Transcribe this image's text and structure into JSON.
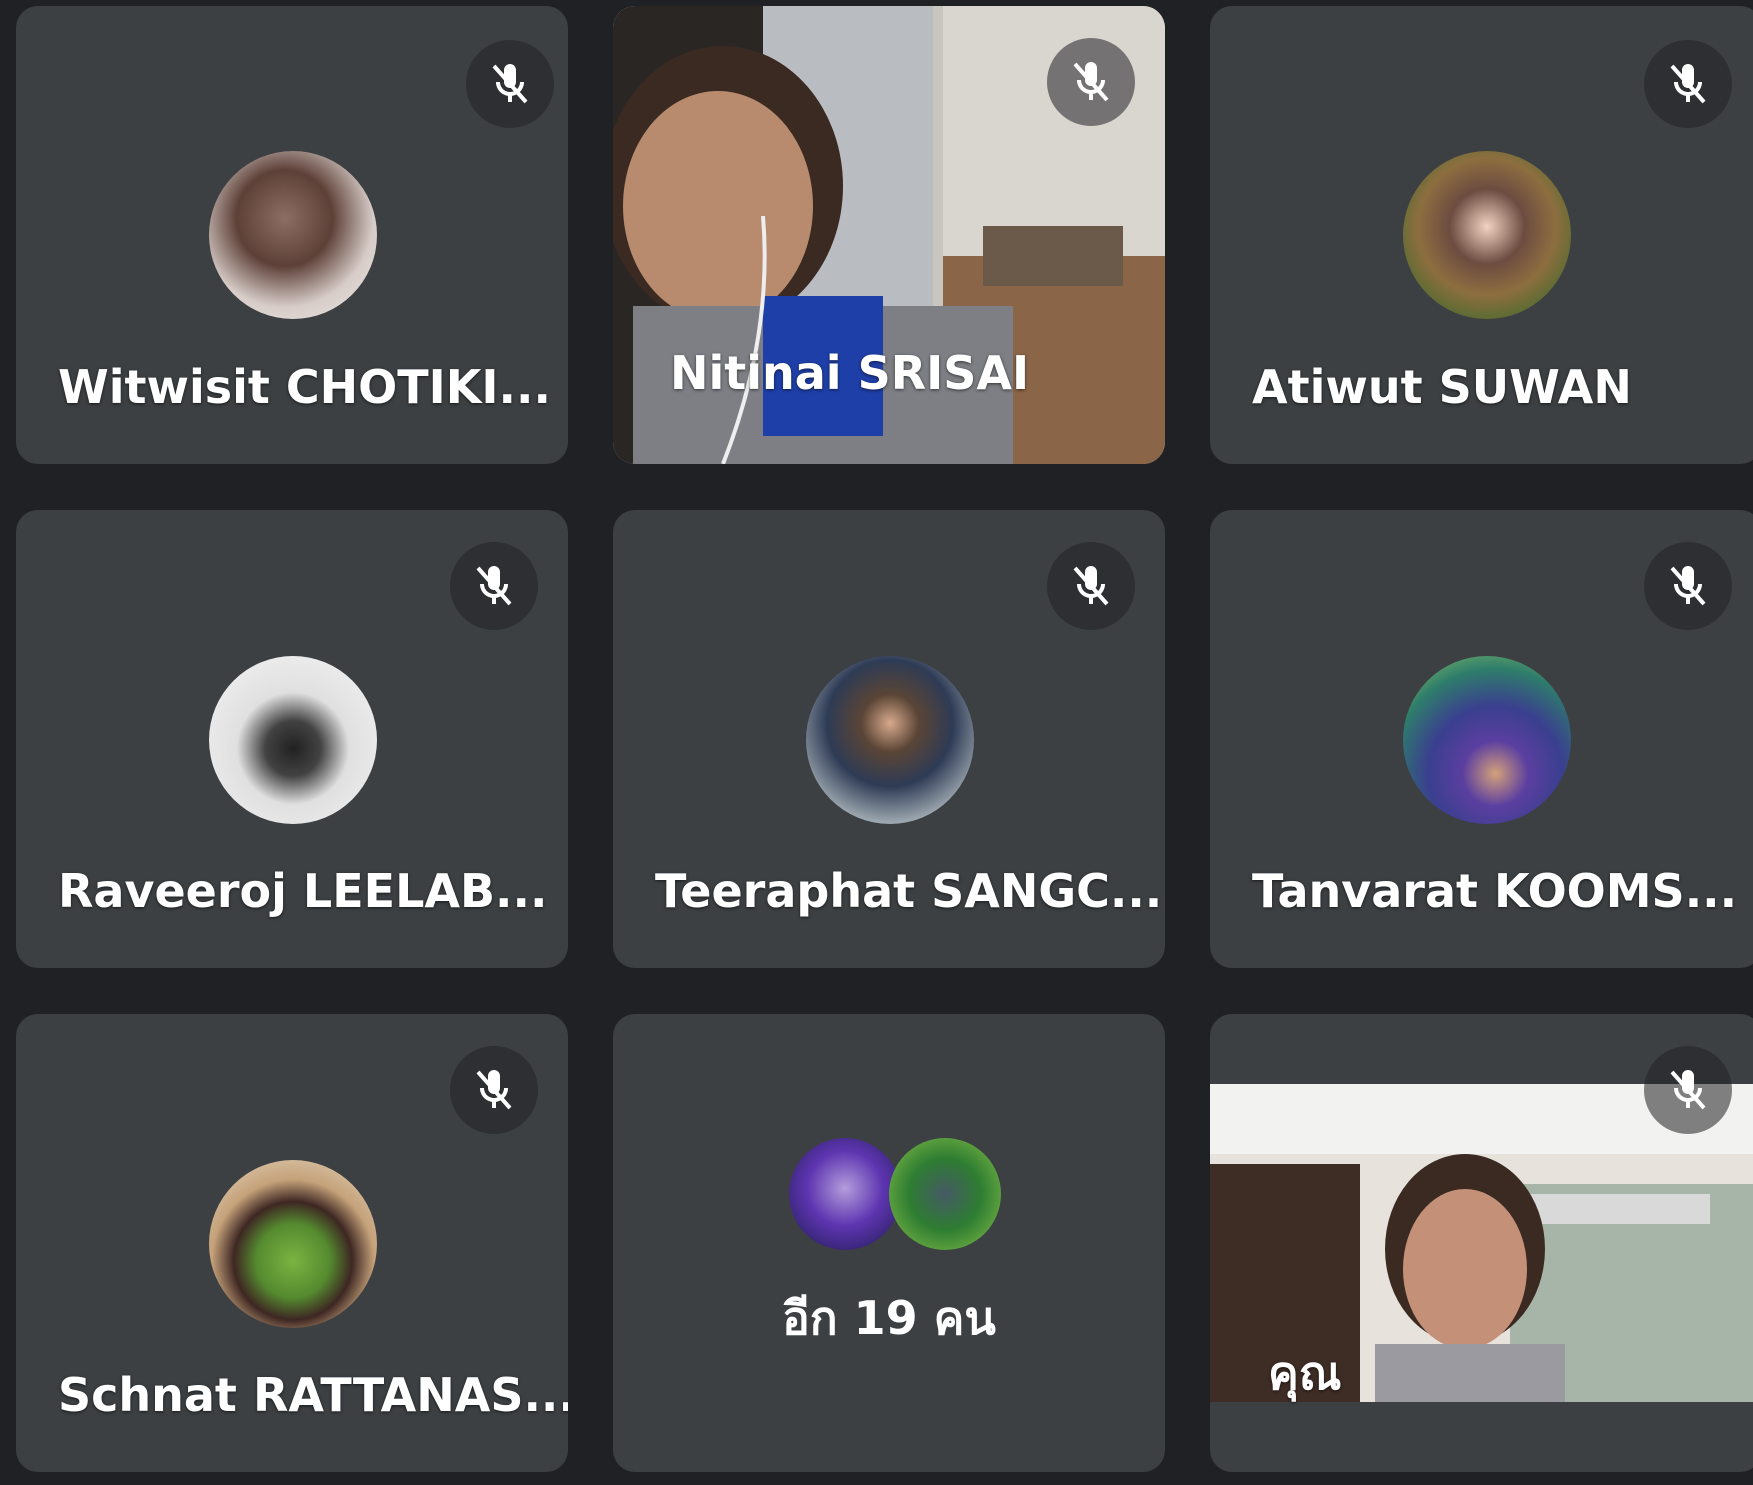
{
  "participants": [
    {
      "name": "Witwisit CHOTIKI...",
      "muted": true,
      "avatar": "photo-avatar"
    },
    {
      "name": "Nitinai SRISAI",
      "muted": true,
      "avatar": "video-feed"
    },
    {
      "name": "Atiwut SUWAN",
      "muted": true,
      "avatar": "photo-avatar"
    },
    {
      "name": "Raveeroj LEELAB...",
      "muted": true,
      "avatar": "photo-avatar"
    },
    {
      "name": "Teeraphat SANGC...",
      "muted": true,
      "avatar": "photo-avatar"
    },
    {
      "name": "Tanvarat KOOMS...",
      "muted": true,
      "avatar": "photo-avatar"
    },
    {
      "name": "Schnat RATTANAS...",
      "muted": true,
      "avatar": "photo-avatar"
    }
  ],
  "more_tile": {
    "label": "อีก 19 คน"
  },
  "self_tile": {
    "label": "คุณ",
    "muted": true
  },
  "colors": {
    "background": "#1f2125",
    "tile": "#3c4043",
    "mic_bg": "#2b2d30",
    "text": "#ffffff"
  },
  "icons": {
    "mic": "mic-off-icon"
  }
}
